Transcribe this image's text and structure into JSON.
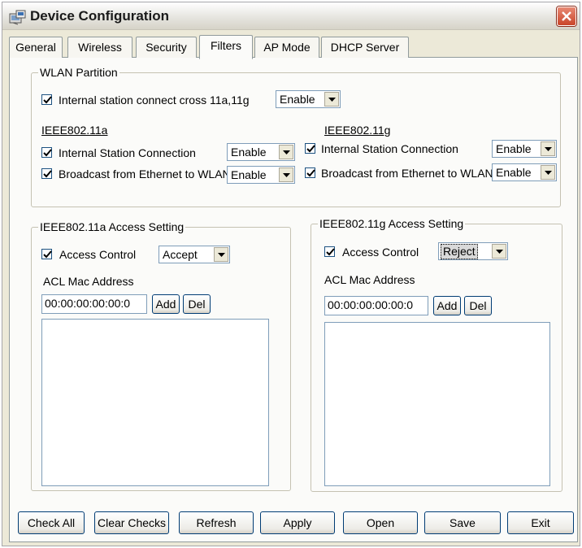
{
  "window": {
    "title": "Device Configuration"
  },
  "tabs": [
    {
      "label": "General"
    },
    {
      "label": "Wireless"
    },
    {
      "label": "Security"
    },
    {
      "label": "Filters",
      "active": true
    },
    {
      "label": "AP Mode"
    },
    {
      "label": "DHCP Server"
    }
  ],
  "wlan_partition": {
    "title": "WLAN Partition",
    "cross": {
      "label": "Internal station connect cross 11a,11g",
      "checked": true,
      "value": "Enable"
    },
    "a": {
      "heading": "IEEE802.11a",
      "internal": {
        "label": "Internal Station Connection",
        "checked": true,
        "value": "Enable"
      },
      "broadcast": {
        "label": "Broadcast from Ethernet to WLAN",
        "checked": true,
        "value": "Enable"
      }
    },
    "g": {
      "heading": "IEEE802.11g",
      "internal": {
        "label": "Internal Station Connection",
        "checked": true,
        "value": "Enable"
      },
      "broadcast": {
        "label": "Broadcast from Ethernet to WLAN",
        "checked": true,
        "value": "Enable"
      }
    }
  },
  "access_a": {
    "title": "IEEE802.11a Access Setting",
    "access_label": "Access Control",
    "checked": true,
    "mode": "Accept",
    "acl_label": "ACL Mac Address",
    "mac": "00:00:00:00:00:0",
    "add": "Add",
    "del": "Del"
  },
  "access_g": {
    "title": "IEEE802.11g Access Setting",
    "access_label": "Access Control",
    "checked": true,
    "mode": "Reject",
    "acl_label": "ACL Mac Address",
    "mac": "00:00:00:00:00:0",
    "add": "Add",
    "del": "Del"
  },
  "buttons": {
    "check_all": "Check All",
    "clear_checks": "Clear Checks",
    "refresh": "Refresh",
    "apply": "Apply",
    "open": "Open",
    "save": "Save",
    "exit": "Exit"
  }
}
